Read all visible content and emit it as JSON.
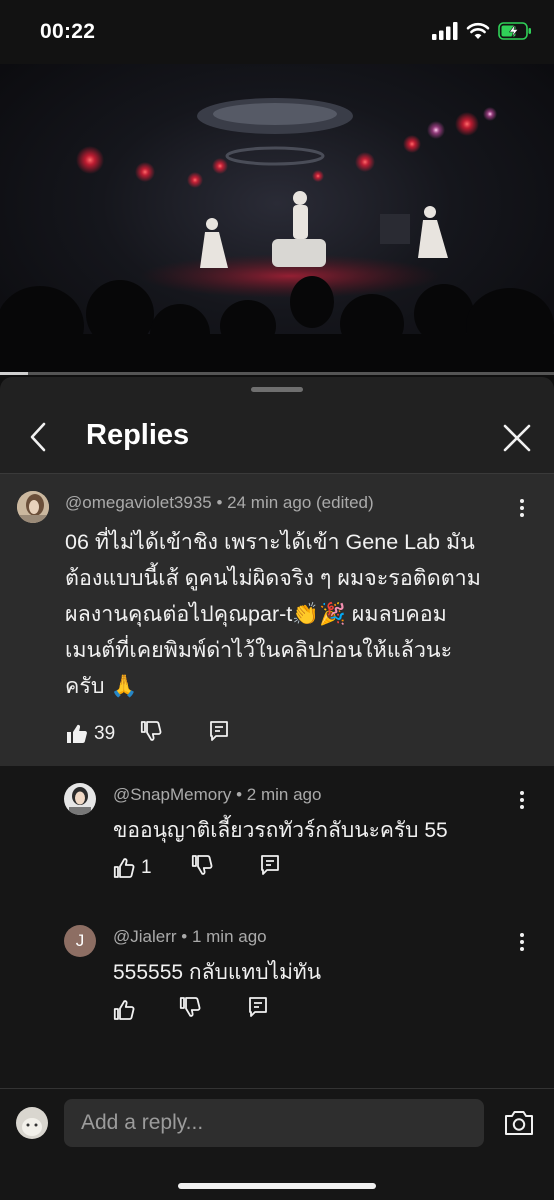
{
  "status_bar": {
    "time": "00:22",
    "icons": [
      "cellular-signal-icon",
      "wifi-icon",
      "battery-charging-icon"
    ],
    "battery_color": "#30d158"
  },
  "video": {
    "progress_fraction": 0.05
  },
  "sheet": {
    "title": "Replies",
    "icons": [
      "back-chevron-icon",
      "close-icon"
    ]
  },
  "main_comment": {
    "author": "@omegaviolet3935",
    "time": "24 min ago (edited)",
    "text_lines": [
      "06 ที่ไม่ได้เข้าชิง เพราะได้เข้า Gene Lab มัน",
      "ต้องแบบนี้เส้ ดูคนไม่ผิดจริง ๆ ผมจะรอติดตาม",
      "ผลงานคุณต่อไปคุณpar-t👏🎉 ผมลบคอม",
      "เมนต์ที่เคยพิมพ์ด่าไว้ในคลิปก่อนให้แล้วนะ",
      "ครับ 🙏"
    ],
    "like_count": "39",
    "liked": true
  },
  "replies": [
    {
      "author": "@SnapMemory",
      "time": "2 min ago",
      "text": "ขออนุญาติเลี้ยวรถทัวร์กลับนะครับ 55",
      "like_count": "1",
      "avatar_initial": ""
    },
    {
      "author": "@Jialerr",
      "time": "1 min ago",
      "text": "555555 กลับแทบไม่ทัน",
      "like_count": "",
      "avatar_initial": "J",
      "avatar_color": "#8d6e63"
    }
  ],
  "composer": {
    "placeholder": "Add a reply...",
    "icons": [
      "camera-icon"
    ]
  },
  "colors": {
    "background": "#0f0f0f",
    "sheet": "#212121",
    "highlight": "#2c2c2c",
    "text": "#f1f1f1",
    "meta": "#aaaaaa"
  }
}
